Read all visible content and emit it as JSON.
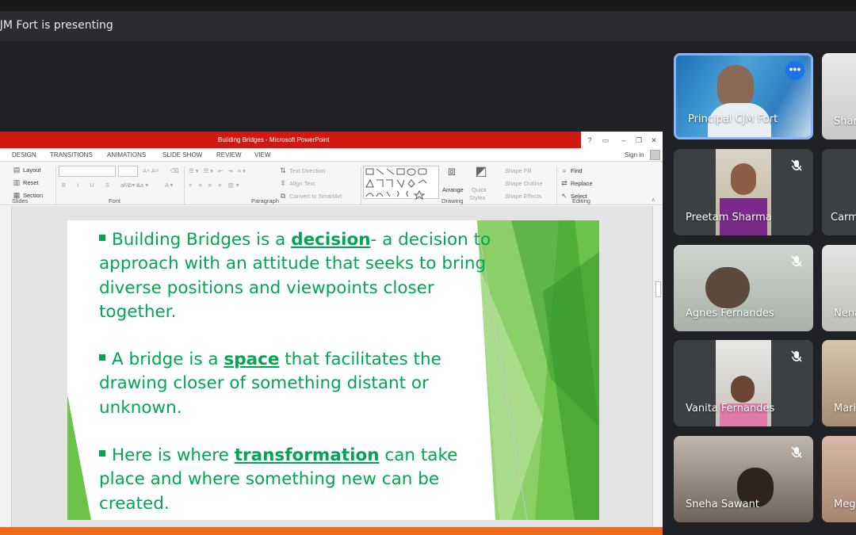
{
  "meeting": {
    "presenting_label": "CJM Fort is presenting"
  },
  "powerpoint": {
    "window_title": "Building Bridges - Microsoft PowerPoint",
    "tabs": [
      "DESIGN",
      "TRANSITIONS",
      "ANIMATIONS",
      "SLIDE SHOW",
      "REVIEW",
      "VIEW"
    ],
    "sign_in": "Sign in",
    "ribbon": {
      "slides": {
        "layout": "Layout",
        "reset": "Reset",
        "section": "Section",
        "group": "Slides"
      },
      "font": {
        "group": "Font"
      },
      "paragraph": {
        "text_direction": "Text Direction",
        "align_text": "Align Text",
        "convert": "Convert to SmartArt",
        "group": "Paragraph"
      },
      "drawing": {
        "arrange": "Arrange",
        "quick": "Quick",
        "styles": "Styles",
        "shape_fill": "Shape Fill",
        "shape_outline": "Shape Outline",
        "shape_effects": "Shape Effects",
        "group": "Drawing"
      },
      "editing": {
        "find": "Find",
        "replace": "Replace",
        "select": "Select",
        "group": "Editing"
      }
    }
  },
  "slide": {
    "bullets": [
      {
        "pre": "Building Bridges is a ",
        "kw": "decision",
        "post": "- a decision to approach with an attitude that seeks to bring diverse positions and viewpoints closer together."
      },
      {
        "pre": "A bridge is a ",
        "kw": "space",
        "post": " that facilitates the drawing closer  of something distant or unknown."
      },
      {
        "pre": "Here is where ",
        "kw": "transformation",
        "post": " can take place and where something new can be created."
      }
    ]
  },
  "participants": [
    {
      "name": "Principal CJM Fort",
      "muted": false,
      "active": true
    },
    {
      "name": "Preetam Sharma",
      "muted": true
    },
    {
      "name": "Agnes Fernandes",
      "muted": true
    },
    {
      "name": "Vanita Fernandes",
      "muted": true
    },
    {
      "name": "Sneha Sawant",
      "muted": true
    }
  ],
  "participants_partial": [
    "Shar",
    "Carm",
    "Nena",
    "Mari",
    "Meg"
  ],
  "colors": {
    "accent": "#8ab4f8",
    "slide_text": "#00a651",
    "ppt_red": "#d01913",
    "tile_bg": "#3c4043"
  }
}
